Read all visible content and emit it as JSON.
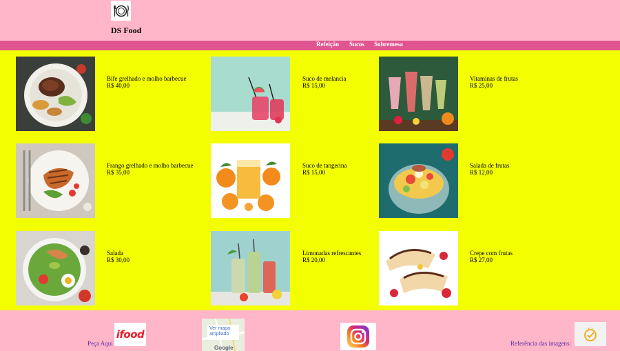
{
  "header": {
    "logo_icon": "plate-cutlery-icon",
    "brand": "DS Food"
  },
  "nav": {
    "items": [
      {
        "label": "Refeição"
      },
      {
        "label": "Sucos"
      },
      {
        "label": "Sobremesa"
      }
    ]
  },
  "menu": {
    "items": [
      {
        "name": "Bife grelhado e molho barbecue",
        "price": "R$ 40,00",
        "image": "steak-plate"
      },
      {
        "name": "Suco de melancia",
        "price": "R$ 15,00",
        "image": "watermelon-juice"
      },
      {
        "name": "Vitaminas de frutas",
        "price": "R$ 25,00",
        "image": "fruit-smoothies"
      },
      {
        "name": "Frango grelhado e molho barbecue",
        "price": "R$ 35,00",
        "image": "grilled-chicken"
      },
      {
        "name": "Suco de tangerina",
        "price": "R$ 15,00",
        "image": "tangerine-juice"
      },
      {
        "name": "Salada de frutas",
        "price": "R$ 12,00",
        "image": "fruit-salad"
      },
      {
        "name": "Salada",
        "price": "R$ 30,00",
        "image": "salad-bowl"
      },
      {
        "name": "Limonadas refrescantes",
        "price": "R$ 20,00",
        "image": "lemonades"
      },
      {
        "name": "Crepe com frutas",
        "price": "R$ 27,00",
        "image": "crepe-fruits"
      }
    ]
  },
  "footer": {
    "order_label": "Peça Aqui",
    "ifood_logo": "ifood",
    "map_link": "Ver mapa ampliado",
    "map_brand": "Google",
    "instagram_icon": "instagram-icon",
    "references_label": "Referência das imagens:",
    "check_icon": "check-badge-icon"
  },
  "colors": {
    "header_bg": "#ffb6c9",
    "nav_bg": "#e05590",
    "main_bg": "#f3ff00",
    "footer_text": "#5a2ea6",
    "ifood_red": "#ea1d2c"
  }
}
